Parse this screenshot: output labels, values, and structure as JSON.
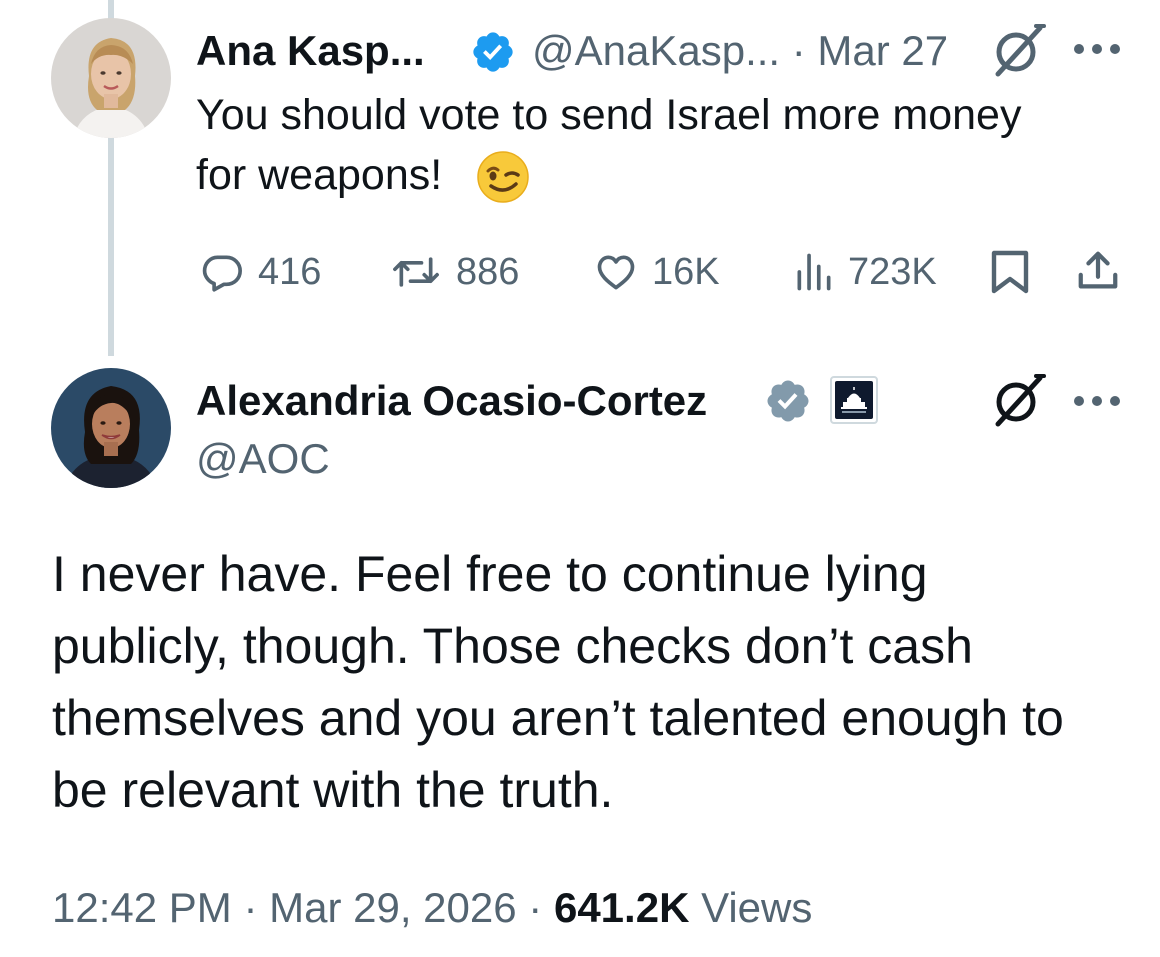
{
  "tweet_parent": {
    "author_name": "Ana Kasp...",
    "handle_date": "@AnaKasp... · Mar 27",
    "text_line1": "You should vote to send Israel more money",
    "text_line2": "for weapons!",
    "emoji": "winking-face",
    "actions": {
      "replies": "416",
      "reposts": "886",
      "likes": "16K",
      "views": "723K"
    }
  },
  "tweet_main": {
    "author_name": "Alexandria Ocasio-Cortez",
    "handle": "@AOC",
    "text_lines": [
      "I never have. Feel free to continue lying",
      "publicly, though. Those checks don’t cash",
      "themselves and you aren’t talented enough to",
      "be relevant with the truth."
    ],
    "footer": {
      "time": "12:42 PM",
      "separator": "·",
      "date": "Mar 29, 2026",
      "views_count": "641.2K",
      "views_label": "Views"
    }
  },
  "colors": {
    "text": "#0f1419",
    "muted": "#536471",
    "verified_blue": "#1d9bf0",
    "verified_gray": "#829aab",
    "thread_line": "#cfd9de"
  },
  "icons": {
    "verified_blue": "verified-badge-blue-icon",
    "verified_gray": "verified-badge-gray-icon",
    "affiliate": "capitol-building-icon",
    "grok": "grok-icon",
    "more": "more-dots-icon",
    "reply": "reply-icon",
    "repost": "repost-icon",
    "like": "heart-icon",
    "views": "views-bar-chart-icon",
    "bookmark": "bookmark-icon",
    "share": "share-icon"
  }
}
